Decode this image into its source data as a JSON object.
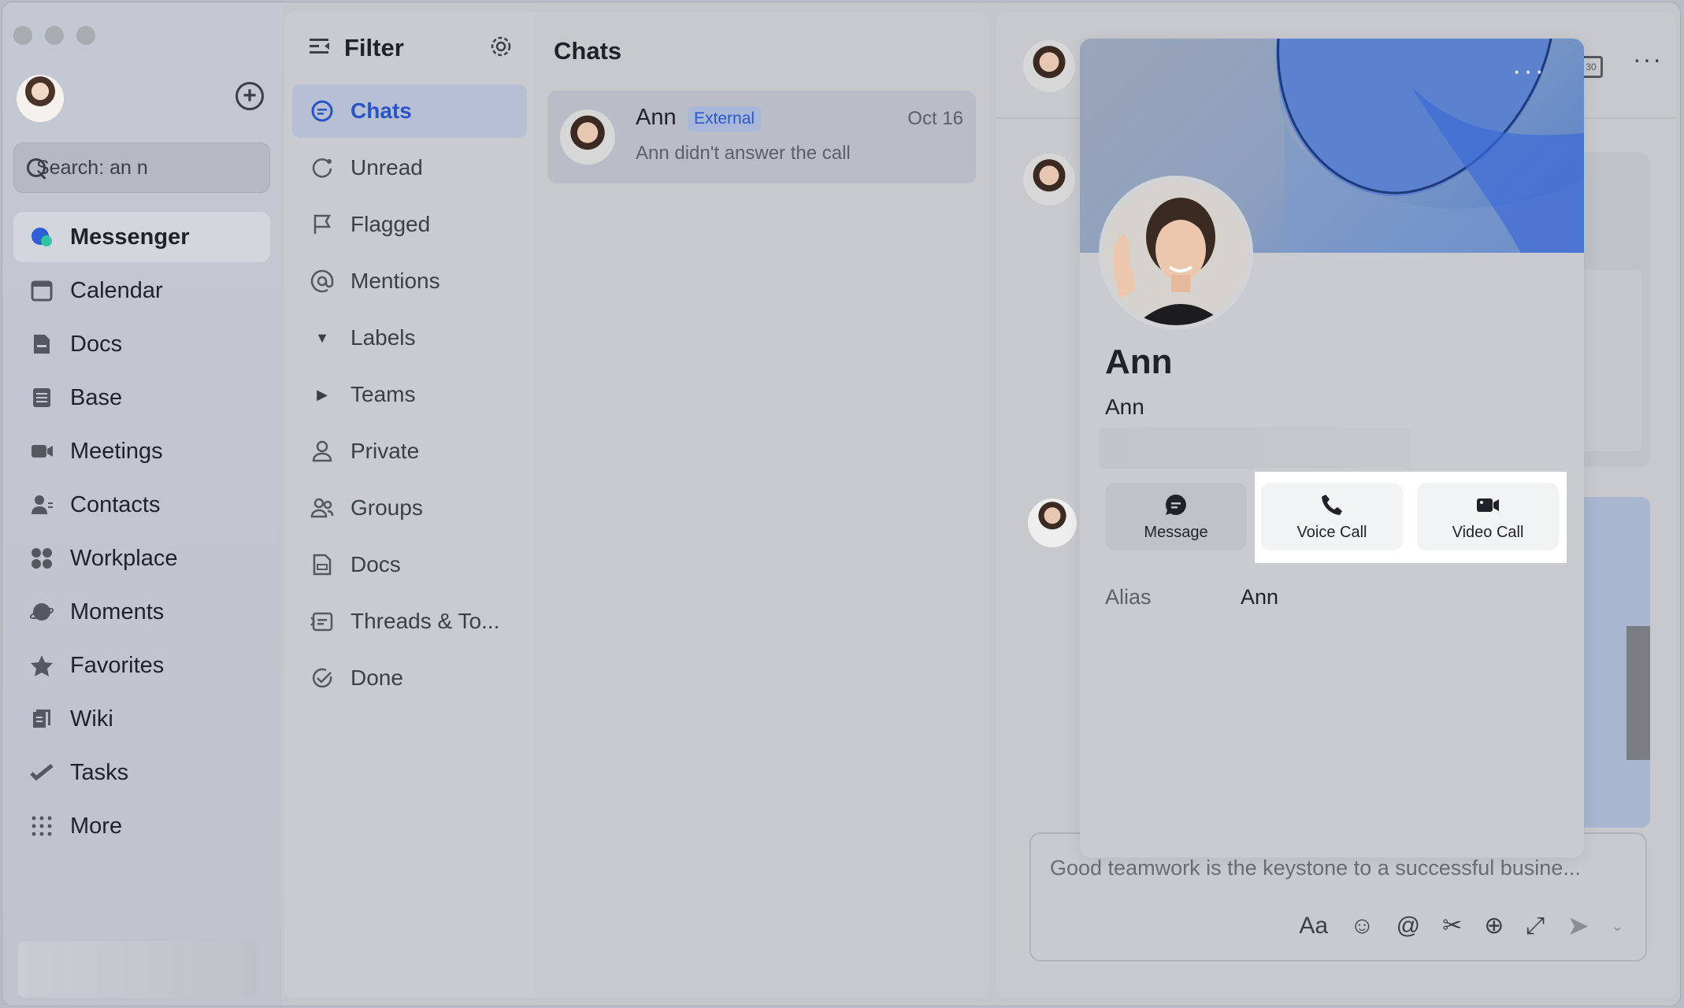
{
  "search": {
    "value": "Search: an n"
  },
  "nav": {
    "items": [
      {
        "label": "Messenger",
        "icon": "messenger-icon",
        "active": true
      },
      {
        "label": "Calendar",
        "icon": "calendar-icon"
      },
      {
        "label": "Docs",
        "icon": "docs-icon"
      },
      {
        "label": "Base",
        "icon": "base-icon"
      },
      {
        "label": "Meetings",
        "icon": "meetings-icon"
      },
      {
        "label": "Contacts",
        "icon": "contacts-icon"
      },
      {
        "label": "Workplace",
        "icon": "workplace-icon"
      },
      {
        "label": "Moments",
        "icon": "moments-icon"
      },
      {
        "label": "Favorites",
        "icon": "star-icon"
      },
      {
        "label": "Wiki",
        "icon": "wiki-icon"
      },
      {
        "label": "Tasks",
        "icon": "tasks-icon"
      },
      {
        "label": "More",
        "icon": "grid-icon"
      }
    ]
  },
  "filter": {
    "title": "Filter",
    "items": [
      {
        "label": "Chats",
        "icon": "chat-icon",
        "active": true
      },
      {
        "label": "Unread",
        "icon": "unread-icon"
      },
      {
        "label": "Flagged",
        "icon": "flag-icon"
      },
      {
        "label": "Mentions",
        "icon": "at-icon"
      },
      {
        "label": "Labels",
        "icon": "caret-down-icon"
      },
      {
        "label": "Teams",
        "icon": "caret-right-icon"
      },
      {
        "label": "Private",
        "icon": "person-icon"
      },
      {
        "label": "Groups",
        "icon": "group-icon"
      },
      {
        "label": "Docs",
        "icon": "docs-icon"
      },
      {
        "label": "Threads & To...",
        "icon": "threads-icon"
      },
      {
        "label": "Done",
        "icon": "done-icon"
      }
    ]
  },
  "chats": {
    "title": "Chats",
    "rows": [
      {
        "name": "Ann",
        "tag": "External",
        "date": "Oct 16",
        "preview": "Ann didn't answer the call"
      }
    ]
  },
  "calendar_badge": "30",
  "composer": {
    "placeholder": "Good teamwork is the keystone to a successful busine...",
    "font_label": "Aa"
  },
  "profile": {
    "name": "Ann",
    "subtitle": "Ann",
    "actions": {
      "message": "Message",
      "voice": "Voice Call",
      "video": "Video Call"
    },
    "alias_label": "Alias",
    "alias_value": "Ann"
  },
  "colors": {
    "accent": "#2a52c9",
    "tag_bg": "#a9b8d9",
    "highlight": "#ffffff"
  }
}
